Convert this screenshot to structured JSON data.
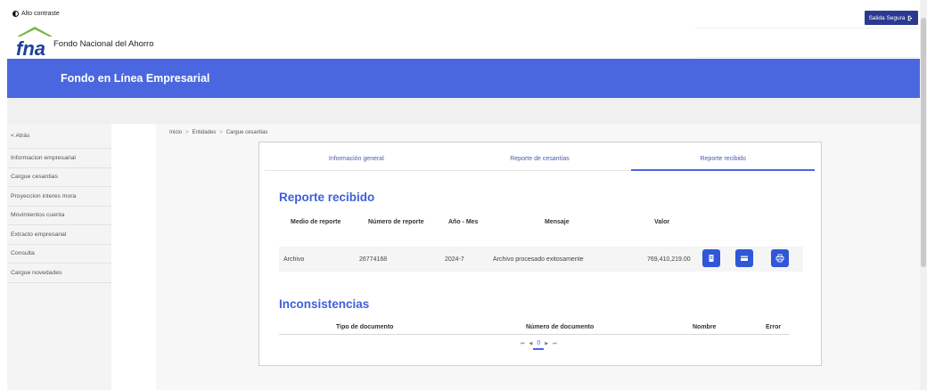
{
  "header": {
    "high_contrast": "Alto contraste",
    "logo_text": "Fondo Nacional del Ahorro",
    "exit_button": "Salida Segura",
    "brand_color": "#4b67e0",
    "logo_green": "#7ab648",
    "logo_blue": "#1f3f9a"
  },
  "banner": {
    "title": "Fondo en Línea Empresarial"
  },
  "sidebar": {
    "items": [
      {
        "label": "< Atrás"
      },
      {
        "label": "Informacion empresarial"
      },
      {
        "label": "Cargue cesantias"
      },
      {
        "label": "Proyeccion interes mora"
      },
      {
        "label": "Movimientos cuenta"
      },
      {
        "label": "Extracto empresarial"
      },
      {
        "label": "Consulta"
      },
      {
        "label": "Cargue novedades"
      }
    ]
  },
  "breadcrumb": {
    "items": [
      "Inicio",
      "Entidades",
      "Cargue cesantias"
    ],
    "separator": ">"
  },
  "tabs": [
    {
      "label": "Información general"
    },
    {
      "label": "Reporte de cesantías"
    },
    {
      "label": "Reporte recibido",
      "active": true
    }
  ],
  "report": {
    "title": "Reporte recibido",
    "columns": [
      "Medio de reporte",
      "Número de reporte",
      "Año - Mes",
      "Mensaje",
      "Valor"
    ],
    "row": {
      "medio": "Archivo",
      "numero": "26774168",
      "anio_mes": "2024-7",
      "mensaje": "Archivo procesado exitosamente",
      "valor": "769,410,219.00"
    },
    "actions": [
      "document-icon",
      "card-icon",
      "print-icon"
    ]
  },
  "inconsistencies": {
    "title": "Inconsistencias",
    "columns": [
      "Tipo de documento",
      "Número de documento",
      "Nombre",
      "Error"
    ],
    "pager": {
      "first": "⏮",
      "prev": "◀",
      "page": "0",
      "next": "▶",
      "last": "⏭"
    }
  }
}
